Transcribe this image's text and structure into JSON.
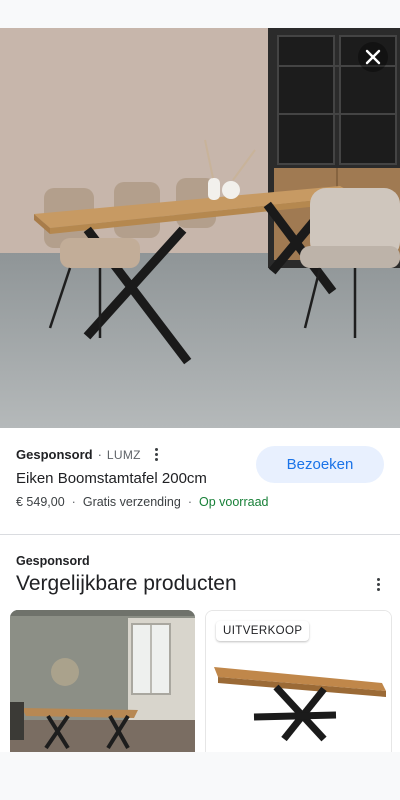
{
  "hero": {
    "close_icon": "close-icon"
  },
  "product": {
    "sponsored_label": "Gesponsord",
    "separator": "·",
    "brand": "LUMZ",
    "title": "Eiken Boomstamtafel 200cm",
    "price": "€ 549,00",
    "shipping": "Gratis verzending",
    "stock": "Op voorraad",
    "visit_label": "Bezoeken"
  },
  "similar": {
    "sponsored_label": "Gesponsord",
    "title": "Vergelijkbare producten",
    "tiles": [
      {
        "badge": ""
      },
      {
        "badge": "UITVERKOOP"
      }
    ]
  },
  "colors": {
    "accent": "#1a73e8",
    "visit_bg": "#e8f0fe",
    "stock_green": "#188038"
  }
}
